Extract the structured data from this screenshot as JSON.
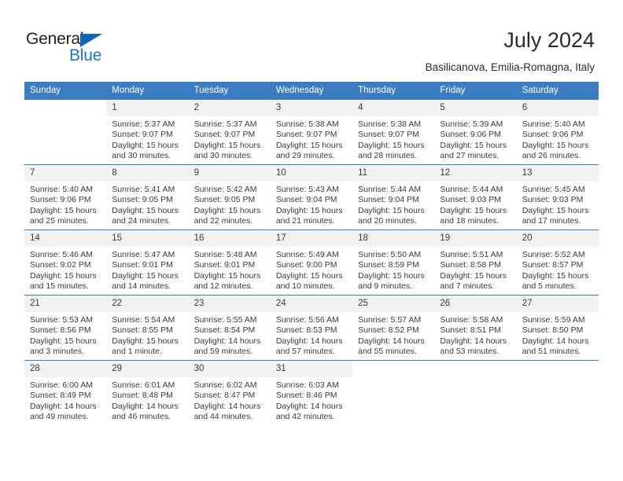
{
  "brand": {
    "name_part1": "General",
    "name_part2": "Blue",
    "triangle_icon": "triangle-icon",
    "accent_color": "#1b74c4"
  },
  "header": {
    "title": "July 2024",
    "subtitle": "Basilicanova, Emilia-Romagna, Italy"
  },
  "calendar": {
    "header_bg": "#3b7dc0",
    "weekdays": [
      "Sunday",
      "Monday",
      "Tuesday",
      "Wednesday",
      "Thursday",
      "Friday",
      "Saturday"
    ],
    "labels": {
      "sunrise": "Sunrise:",
      "sunset": "Sunset:",
      "daylight": "Daylight:"
    },
    "weeks": [
      [
        {
          "day": "",
          "sunrise": "",
          "sunset": "",
          "daylight": "",
          "empty": true
        },
        {
          "day": "1",
          "sunrise": "Sunrise: 5:37 AM",
          "sunset": "Sunset: 9:07 PM",
          "daylight": "Daylight: 15 hours and 30 minutes."
        },
        {
          "day": "2",
          "sunrise": "Sunrise: 5:37 AM",
          "sunset": "Sunset: 9:07 PM",
          "daylight": "Daylight: 15 hours and 30 minutes."
        },
        {
          "day": "3",
          "sunrise": "Sunrise: 5:38 AM",
          "sunset": "Sunset: 9:07 PM",
          "daylight": "Daylight: 15 hours and 29 minutes."
        },
        {
          "day": "4",
          "sunrise": "Sunrise: 5:38 AM",
          "sunset": "Sunset: 9:07 PM",
          "daylight": "Daylight: 15 hours and 28 minutes."
        },
        {
          "day": "5",
          "sunrise": "Sunrise: 5:39 AM",
          "sunset": "Sunset: 9:06 PM",
          "daylight": "Daylight: 15 hours and 27 minutes."
        },
        {
          "day": "6",
          "sunrise": "Sunrise: 5:40 AM",
          "sunset": "Sunset: 9:06 PM",
          "daylight": "Daylight: 15 hours and 26 minutes."
        }
      ],
      [
        {
          "day": "7",
          "sunrise": "Sunrise: 5:40 AM",
          "sunset": "Sunset: 9:06 PM",
          "daylight": "Daylight: 15 hours and 25 minutes."
        },
        {
          "day": "8",
          "sunrise": "Sunrise: 5:41 AM",
          "sunset": "Sunset: 9:05 PM",
          "daylight": "Daylight: 15 hours and 24 minutes."
        },
        {
          "day": "9",
          "sunrise": "Sunrise: 5:42 AM",
          "sunset": "Sunset: 9:05 PM",
          "daylight": "Daylight: 15 hours and 22 minutes."
        },
        {
          "day": "10",
          "sunrise": "Sunrise: 5:43 AM",
          "sunset": "Sunset: 9:04 PM",
          "daylight": "Daylight: 15 hours and 21 minutes."
        },
        {
          "day": "11",
          "sunrise": "Sunrise: 5:44 AM",
          "sunset": "Sunset: 9:04 PM",
          "daylight": "Daylight: 15 hours and 20 minutes."
        },
        {
          "day": "12",
          "sunrise": "Sunrise: 5:44 AM",
          "sunset": "Sunset: 9:03 PM",
          "daylight": "Daylight: 15 hours and 18 minutes."
        },
        {
          "day": "13",
          "sunrise": "Sunrise: 5:45 AM",
          "sunset": "Sunset: 9:03 PM",
          "daylight": "Daylight: 15 hours and 17 minutes."
        }
      ],
      [
        {
          "day": "14",
          "sunrise": "Sunrise: 5:46 AM",
          "sunset": "Sunset: 9:02 PM",
          "daylight": "Daylight: 15 hours and 15 minutes."
        },
        {
          "day": "15",
          "sunrise": "Sunrise: 5:47 AM",
          "sunset": "Sunset: 9:01 PM",
          "daylight": "Daylight: 15 hours and 14 minutes."
        },
        {
          "day": "16",
          "sunrise": "Sunrise: 5:48 AM",
          "sunset": "Sunset: 9:01 PM",
          "daylight": "Daylight: 15 hours and 12 minutes."
        },
        {
          "day": "17",
          "sunrise": "Sunrise: 5:49 AM",
          "sunset": "Sunset: 9:00 PM",
          "daylight": "Daylight: 15 hours and 10 minutes."
        },
        {
          "day": "18",
          "sunrise": "Sunrise: 5:50 AM",
          "sunset": "Sunset: 8:59 PM",
          "daylight": "Daylight: 15 hours and 9 minutes."
        },
        {
          "day": "19",
          "sunrise": "Sunrise: 5:51 AM",
          "sunset": "Sunset: 8:58 PM",
          "daylight": "Daylight: 15 hours and 7 minutes."
        },
        {
          "day": "20",
          "sunrise": "Sunrise: 5:52 AM",
          "sunset": "Sunset: 8:57 PM",
          "daylight": "Daylight: 15 hours and 5 minutes."
        }
      ],
      [
        {
          "day": "21",
          "sunrise": "Sunrise: 5:53 AM",
          "sunset": "Sunset: 8:56 PM",
          "daylight": "Daylight: 15 hours and 3 minutes."
        },
        {
          "day": "22",
          "sunrise": "Sunrise: 5:54 AM",
          "sunset": "Sunset: 8:55 PM",
          "daylight": "Daylight: 15 hours and 1 minute."
        },
        {
          "day": "23",
          "sunrise": "Sunrise: 5:55 AM",
          "sunset": "Sunset: 8:54 PM",
          "daylight": "Daylight: 14 hours and 59 minutes."
        },
        {
          "day": "24",
          "sunrise": "Sunrise: 5:56 AM",
          "sunset": "Sunset: 8:53 PM",
          "daylight": "Daylight: 14 hours and 57 minutes."
        },
        {
          "day": "25",
          "sunrise": "Sunrise: 5:57 AM",
          "sunset": "Sunset: 8:52 PM",
          "daylight": "Daylight: 14 hours and 55 minutes."
        },
        {
          "day": "26",
          "sunrise": "Sunrise: 5:58 AM",
          "sunset": "Sunset: 8:51 PM",
          "daylight": "Daylight: 14 hours and 53 minutes."
        },
        {
          "day": "27",
          "sunrise": "Sunrise: 5:59 AM",
          "sunset": "Sunset: 8:50 PM",
          "daylight": "Daylight: 14 hours and 51 minutes."
        }
      ],
      [
        {
          "day": "28",
          "sunrise": "Sunrise: 6:00 AM",
          "sunset": "Sunset: 8:49 PM",
          "daylight": "Daylight: 14 hours and 49 minutes."
        },
        {
          "day": "29",
          "sunrise": "Sunrise: 6:01 AM",
          "sunset": "Sunset: 8:48 PM",
          "daylight": "Daylight: 14 hours and 46 minutes."
        },
        {
          "day": "30",
          "sunrise": "Sunrise: 6:02 AM",
          "sunset": "Sunset: 8:47 PM",
          "daylight": "Daylight: 14 hours and 44 minutes."
        },
        {
          "day": "31",
          "sunrise": "Sunrise: 6:03 AM",
          "sunset": "Sunset: 8:46 PM",
          "daylight": "Daylight: 14 hours and 42 minutes."
        },
        {
          "day": "",
          "sunrise": "",
          "sunset": "",
          "daylight": "",
          "empty": true
        },
        {
          "day": "",
          "sunrise": "",
          "sunset": "",
          "daylight": "",
          "empty": true
        },
        {
          "day": "",
          "sunrise": "",
          "sunset": "",
          "daylight": "",
          "empty": true
        }
      ]
    ]
  }
}
